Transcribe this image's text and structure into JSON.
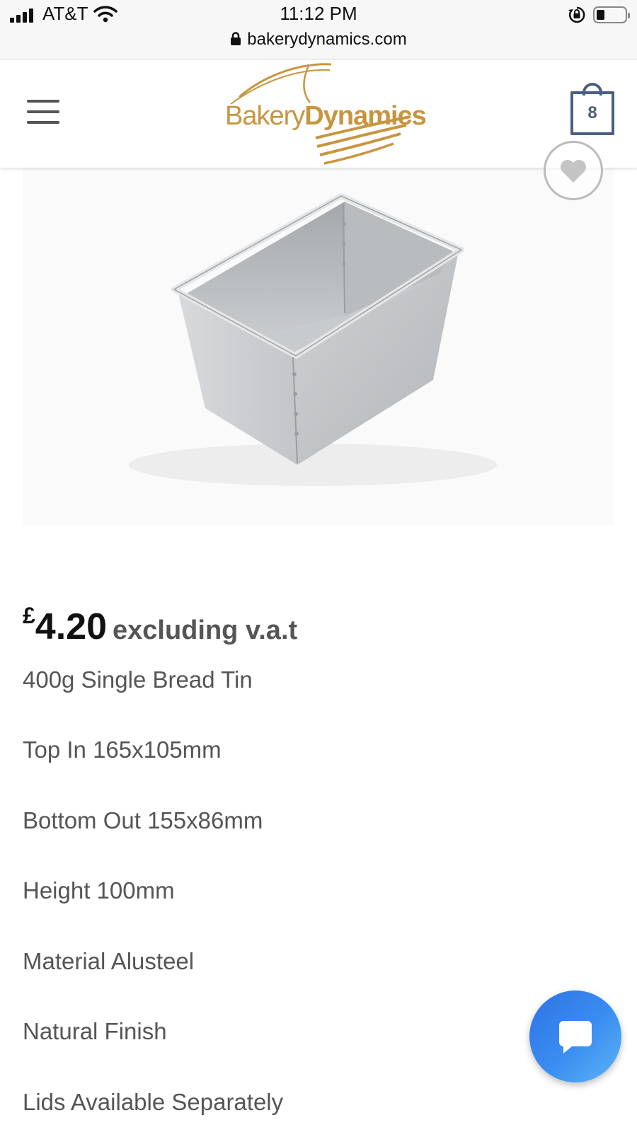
{
  "status_bar": {
    "carrier": "AT&T",
    "time": "11:12 PM",
    "url": "bakerydynamics.com",
    "battery_level": 0.25
  },
  "header": {
    "logo_part1": "Bakery",
    "logo_part2": "Dynamics",
    "cart_count": "8",
    "brand_color": "#c8953f",
    "cart_color": "#4a5f82"
  },
  "product": {
    "currency": "£",
    "price": "4.20",
    "price_note": "excluding v.a.t",
    "details": [
      "400g Single Bread Tin",
      "Top In 165x105mm",
      "Bottom Out 155x86mm",
      "Height 100mm",
      "Material Alusteel",
      "Natural Finish",
      "Lids Available Separately"
    ]
  },
  "chat": {
    "accent": "#2e73e6"
  }
}
